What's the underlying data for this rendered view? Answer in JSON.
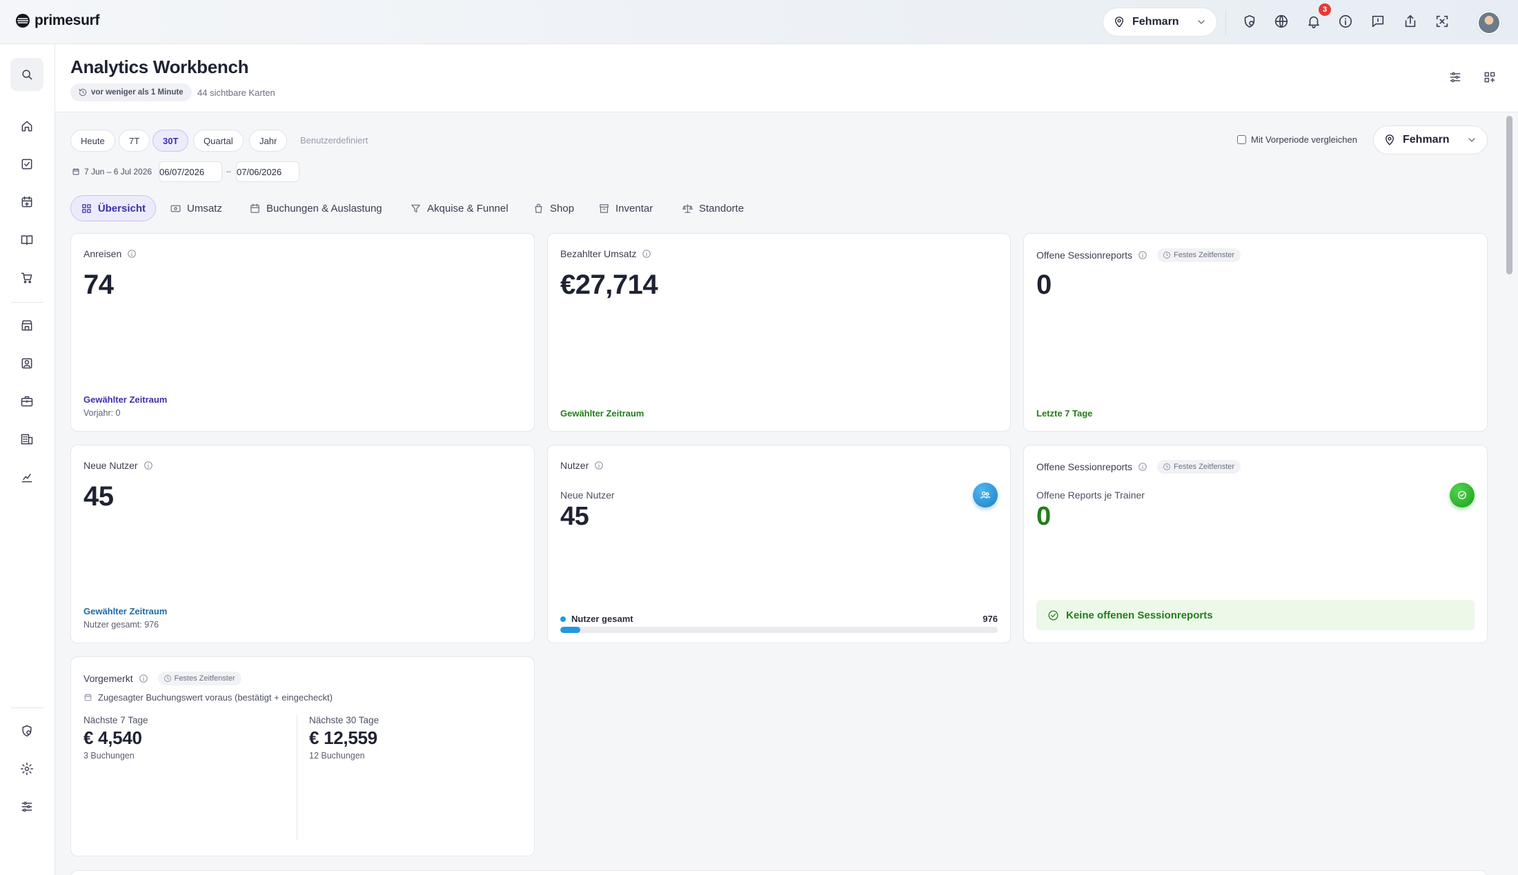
{
  "app": {
    "logo": "primesurf",
    "location": "Fehmarn",
    "notifications_count": "3"
  },
  "header": {
    "title": "Analytics Workbench",
    "updated": "vor weniger als 1 Minute",
    "visible_cards": "44 sichtbare Karten"
  },
  "filters": {
    "ranges": [
      "Heute",
      "7T",
      "30T",
      "Quartal",
      "Jahr"
    ],
    "active_range": "30T",
    "custom": "Benutzerdefiniert",
    "date_summary": "7 Jun – 6 Jul 2026",
    "date_from": "06/07/2026",
    "date_to": "07/06/2026",
    "date_separator": "–",
    "compare_label": "Mit Vorperiode vergleichen",
    "location": "Fehmarn"
  },
  "tabs": [
    {
      "label": "Übersicht",
      "icon": "grid-icon"
    },
    {
      "label": "Umsatz",
      "icon": "cash-icon"
    },
    {
      "label": "Buchungen & Auslastung",
      "icon": "calendar-icon"
    },
    {
      "label": "Akquise & Funnel",
      "icon": "funnel-icon"
    },
    {
      "label": "Shop",
      "icon": "bag-icon"
    },
    {
      "label": "Inventar",
      "icon": "box-icon"
    },
    {
      "label": "Standorte",
      "icon": "scale-icon"
    }
  ],
  "cards": {
    "anreisen": {
      "title": "Anreisen",
      "value": "74",
      "foot": "Gewählter Zeitraum",
      "sub": "Vorjahr: 0"
    },
    "umsatz": {
      "title": "Bezahlter Umsatz",
      "value": "€27,714",
      "foot": "Gewählter Zeitraum"
    },
    "sessionreports": {
      "title": "Offene Sessionreports",
      "chip": "Festes Zeitfenster",
      "value": "0",
      "foot": "Letzte 7 Tage"
    },
    "neue_nutzer": {
      "title": "Neue Nutzer",
      "value": "45",
      "foot": "Gewählter Zeitraum",
      "sub": "Nutzer gesamt: 976"
    },
    "nutzer": {
      "title": "Nutzer",
      "label": "Neue Nutzer",
      "value": "45",
      "progress_label": "Nutzer gesamt",
      "progress_total": "976",
      "progress_fraction": 0.046
    },
    "sessionreports_trainer": {
      "title": "Offene Sessionreports",
      "chip": "Festes Zeitfenster",
      "label": "Offene Reports je Trainer",
      "value": "0",
      "banner": "Keine offenen Sessionreports"
    },
    "vorgemerkt": {
      "title": "Vorgemerkt",
      "chip": "Festes Zeitfenster",
      "desc": "Zugesagter Buchungswert voraus (bestätigt + eingecheckt)",
      "col1": {
        "label": "Nächste 7 Tage",
        "value": "€ 4,540",
        "count": "3 Buchungen"
      },
      "col2": {
        "label": "Nächste 30 Tage",
        "value": "€ 12,559",
        "count": "12 Buchungen"
      }
    }
  }
}
